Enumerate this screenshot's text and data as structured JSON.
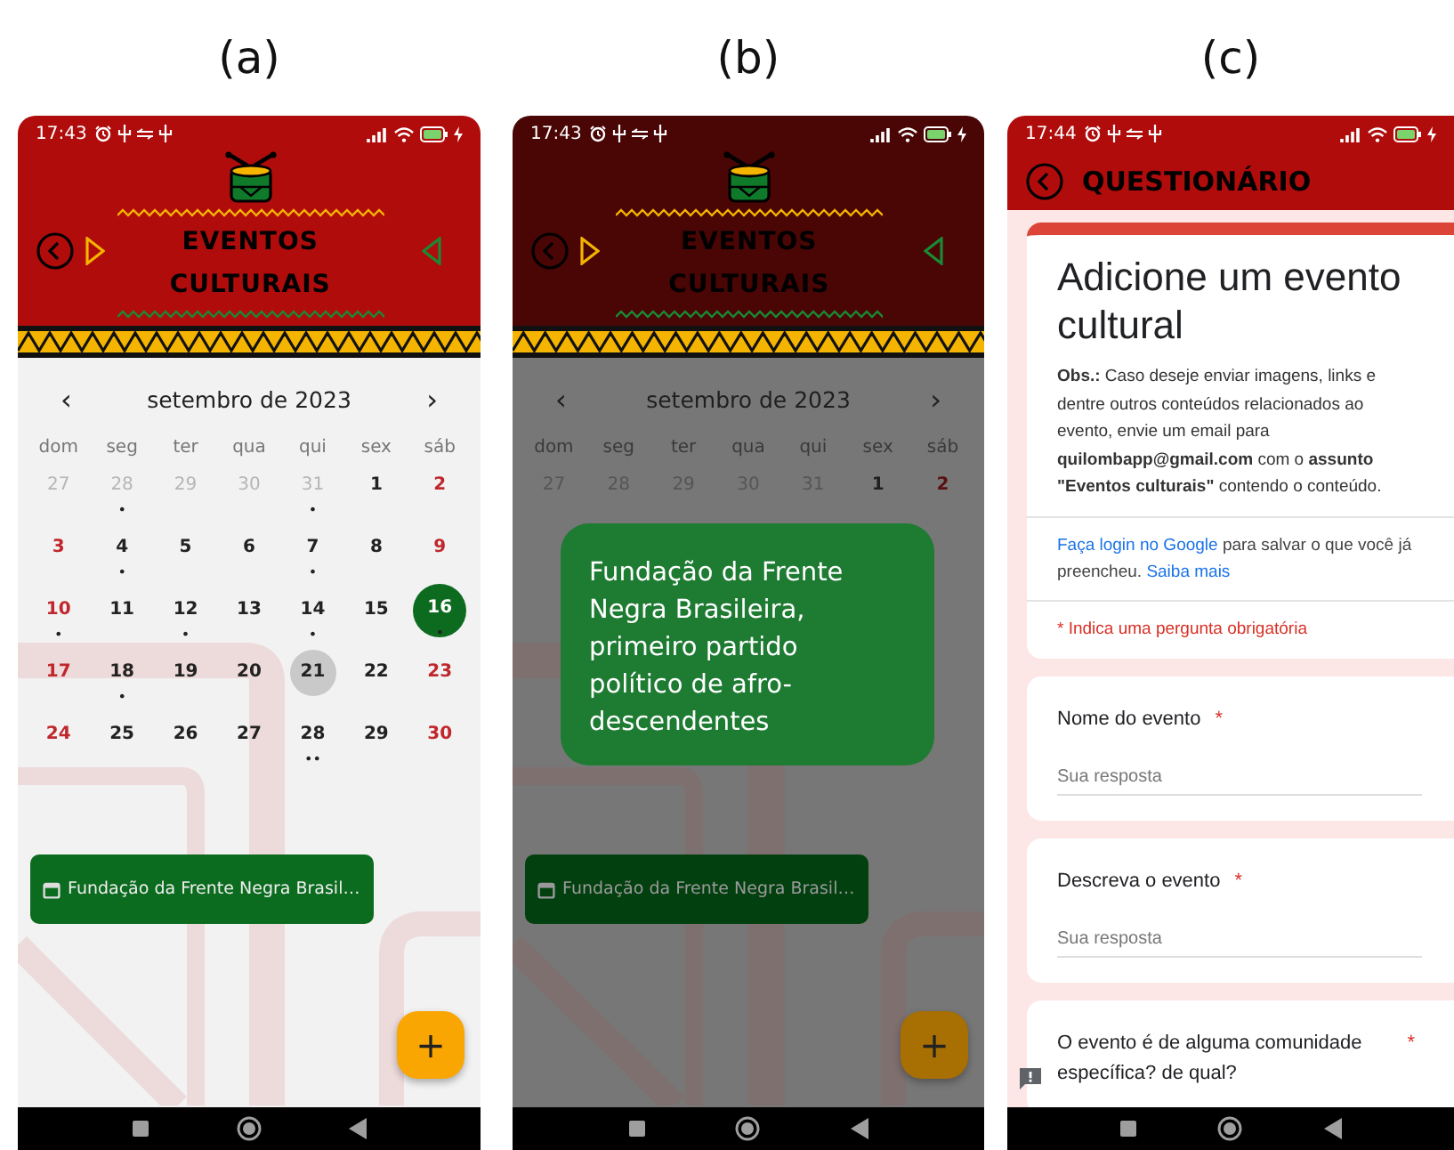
{
  "panels": [
    {
      "label": "(a)",
      "kind": "calendar",
      "dimmed": false,
      "status_bar": {
        "time": "17:43"
      },
      "header": {
        "title": "EVENTOS CULTURAIS"
      },
      "calendar": {
        "prev": "‹",
        "month": "setembro de 2023",
        "next": "›",
        "weekdays": [
          "dom",
          "seg",
          "ter",
          "qua",
          "qui",
          "sex",
          "sáb"
        ],
        "weeks": [
          [
            {
              "day": "27",
              "kind": "outside",
              "selected": false,
              "today": false
            },
            {
              "day": "28",
              "kind": "outside",
              "selected": false,
              "today": false,
              "marks": "•"
            },
            {
              "day": "29",
              "kind": "outside",
              "selected": false,
              "today": false
            },
            {
              "day": "30",
              "kind": "outside",
              "selected": false,
              "today": false
            },
            {
              "day": "31",
              "kind": "outside",
              "selected": false,
              "today": false,
              "marks": "•"
            },
            {
              "day": "1",
              "kind": "weekday",
              "selected": false,
              "today": false
            },
            {
              "day": "2",
              "kind": "weekend",
              "selected": false,
              "today": false
            }
          ],
          [
            {
              "day": "3",
              "kind": "weekend",
              "selected": false,
              "today": false
            },
            {
              "day": "4",
              "kind": "weekday",
              "selected": false,
              "today": false,
              "marks": "•"
            },
            {
              "day": "5",
              "kind": "weekday",
              "selected": false,
              "today": false
            },
            {
              "day": "6",
              "kind": "weekday",
              "selected": false,
              "today": false
            },
            {
              "day": "7",
              "kind": "weekday",
              "selected": false,
              "today": false,
              "marks": "•"
            },
            {
              "day": "8",
              "kind": "weekday",
              "selected": false,
              "today": false
            },
            {
              "day": "9",
              "kind": "weekend",
              "selected": false,
              "today": false
            }
          ],
          [
            {
              "day": "10",
              "kind": "weekend",
              "selected": false,
              "today": false,
              "marks": "•"
            },
            {
              "day": "11",
              "kind": "weekday",
              "selected": false,
              "today": false
            },
            {
              "day": "12",
              "kind": "weekday",
              "selected": false,
              "today": false,
              "marks": "•"
            },
            {
              "day": "13",
              "kind": "weekday",
              "selected": false,
              "today": false
            },
            {
              "day": "14",
              "kind": "weekday",
              "selected": false,
              "today": false,
              "marks": "•"
            },
            {
              "day": "15",
              "kind": "weekday",
              "selected": false,
              "today": false
            },
            {
              "day": "16",
              "kind": "weekend",
              "selected": true,
              "today": false,
              "marks": "•"
            }
          ],
          [
            {
              "day": "17",
              "kind": "weekend",
              "selected": false,
              "today": false
            },
            {
              "day": "18",
              "kind": "weekday",
              "selected": false,
              "today": false,
              "marks": "•"
            },
            {
              "day": "19",
              "kind": "weekday",
              "selected": false,
              "today": false
            },
            {
              "day": "20",
              "kind": "weekday",
              "selected": false,
              "today": false
            },
            {
              "day": "21",
              "kind": "weekday",
              "selected": false,
              "today": true
            },
            {
              "day": "22",
              "kind": "weekday",
              "selected": false,
              "today": false
            },
            {
              "day": "23",
              "kind": "weekend",
              "selected": false,
              "today": false
            }
          ],
          [
            {
              "day": "24",
              "kind": "weekend",
              "selected": false,
              "today": false
            },
            {
              "day": "25",
              "kind": "weekday",
              "selected": false,
              "today": false
            },
            {
              "day": "26",
              "kind": "weekday",
              "selected": false,
              "today": false
            },
            {
              "day": "27",
              "kind": "weekday",
              "selected": false,
              "today": false
            },
            {
              "day": "28",
              "kind": "weekday",
              "selected": false,
              "today": false,
              "marks": "••"
            },
            {
              "day": "29",
              "kind": "weekday",
              "selected": false,
              "today": false
            },
            {
              "day": "30",
              "kind": "weekend",
              "selected": false,
              "today": false
            }
          ]
        ]
      },
      "event_chip": {
        "text": "Fundação da Frente Negra Brasil…"
      },
      "fab": "+"
    },
    {
      "label": "(b)",
      "kind": "calendar",
      "dimmed": true,
      "status_bar": {
        "time": "17:43"
      },
      "header": {
        "title": "EVENTOS CULTURAIS"
      },
      "calendar": {
        "prev": "‹",
        "month": "setembro de 2023",
        "next": "›",
        "weekdays": [
          "dom",
          "seg",
          "ter",
          "qua",
          "qui",
          "sex",
          "sáb"
        ],
        "weeks": [
          [
            {
              "day": "27",
              "kind": "outside",
              "selected": false,
              "today": false
            },
            {
              "day": "28",
              "kind": "outside",
              "selected": false,
              "today": false
            },
            {
              "day": "29",
              "kind": "outside",
              "selected": false,
              "today": false
            },
            {
              "day": "30",
              "kind": "outside",
              "selected": false,
              "today": false
            },
            {
              "day": "31",
              "kind": "outside",
              "selected": false,
              "today": false
            },
            {
              "day": "1",
              "kind": "weekday",
              "selected": false,
              "today": false
            },
            {
              "day": "2",
              "kind": "weekend",
              "selected": false,
              "today": false
            }
          ]
        ]
      },
      "dialog": {
        "text": "Fundação da Frente Negra Brasileira, primeiro partido político de afro-descendentes"
      },
      "event_chip": {
        "text": "Fundação da Frente Negra Brasil…"
      },
      "fab": "+"
    },
    {
      "label": "(c)",
      "kind": "form",
      "dimmed": false,
      "status_bar": {
        "time": "17:44"
      },
      "header": {
        "title": "QUESTIONÁRIO"
      },
      "form": {
        "title": "Adicione um evento cultural",
        "note": "**Obs.:** Caso deseje enviar imagens, links e dentre outros conteúdos relacionados ao evento, envie um email para **quilombapp@gmail.com** com o **assunto \"Eventos culturais\"** contendo o conteúdo.",
        "login": {
          "link": "Faça login no Google",
          "text": "para salvar o que você já preencheu.",
          "link2": "Saiba mais"
        },
        "required_note": "* Indica uma pergunta obrigatória",
        "questions": [
          {
            "label": "Nome do evento",
            "mark": "*",
            "placeholder": "Sua resposta"
          },
          {
            "label": "Descreva o evento",
            "mark": "*",
            "placeholder": "Sua resposta"
          },
          {
            "label": "O evento é de alguma comunidade específica? de qual?",
            "mark": "*"
          }
        ]
      }
    }
  ]
}
